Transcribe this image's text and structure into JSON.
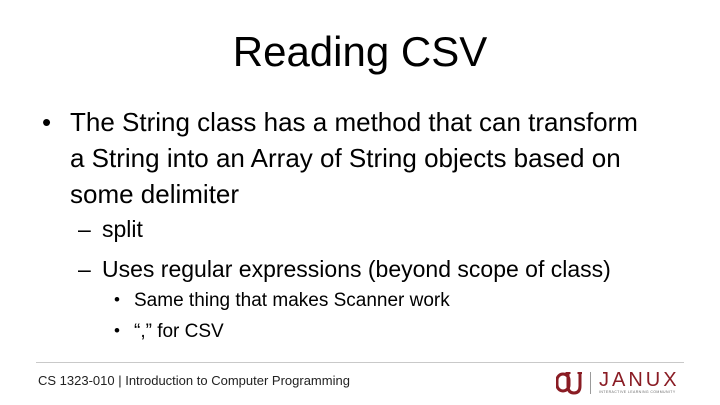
{
  "slide": {
    "title": "Reading CSV",
    "bullets": [
      {
        "marker": "•",
        "text": "The String class has a method that can transform a String into an Array of String objects based on some delimiter",
        "subitems": [
          {
            "marker": "–",
            "text": "split"
          },
          {
            "marker": "–",
            "text": "Uses regular expressions (beyond scope of class)",
            "subitems": [
              {
                "marker": "•",
                "text": "Same thing that makes Scanner work"
              },
              {
                "marker": "•",
                "text": "“,” for CSV"
              }
            ]
          }
        ]
      }
    ]
  },
  "footer": {
    "course": "CS 1323-010 | Introduction to Computer Programming",
    "brand": "JANUX",
    "brand_tagline": "INTERACTIVE LEARNING COMMUNITY",
    "logo_icon": "ou-logo-icon"
  },
  "colors": {
    "text": "#000000",
    "brand_crimson": "#8a1c24",
    "rule": "#c9c9c9"
  }
}
